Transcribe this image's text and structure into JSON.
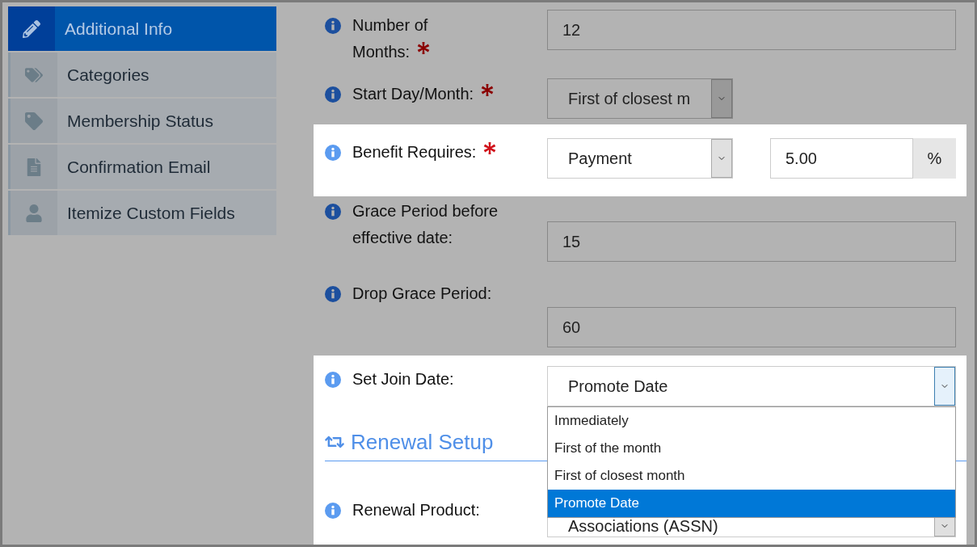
{
  "sidebar": {
    "items": [
      {
        "label": "Additional Info",
        "selected": true
      },
      {
        "label": "Categories",
        "selected": false
      },
      {
        "label": "Membership Status",
        "selected": false
      },
      {
        "label": "Confirmation Email",
        "selected": false
      },
      {
        "label": "Itemize Custom Fields",
        "selected": false
      }
    ]
  },
  "form": {
    "rows": [
      {
        "kind": "input",
        "label": "Number of Months:",
        "required": true,
        "highlighted": false,
        "value": "12"
      },
      {
        "kind": "select",
        "label": "Start Day/Month:",
        "required": true,
        "highlighted": false,
        "value": "First of closest m"
      },
      {
        "kind": "select_amount",
        "label": "Benefit Requires:",
        "required": true,
        "highlighted": true,
        "value": "Payment",
        "amount": "5.00",
        "unit": "%"
      },
      {
        "kind": "input",
        "label": "Grace Period before effective date:",
        "required": false,
        "highlighted": false,
        "value": "15"
      },
      {
        "kind": "stacked_input",
        "label": "Drop Grace Period:",
        "required": false,
        "highlighted": false,
        "value": "60"
      },
      {
        "kind": "open_select",
        "label": "Set Join Date:",
        "required": false,
        "highlighted": true,
        "value": "Promote Date",
        "options": [
          {
            "label": "Immediately",
            "selected": false
          },
          {
            "label": "First of the month",
            "selected": false
          },
          {
            "label": "First of closest month",
            "selected": false
          },
          {
            "label": "Promote Date",
            "selected": true
          }
        ]
      },
      {
        "kind": "heading",
        "label": "Renewal Setup",
        "highlighted": true
      },
      {
        "kind": "select",
        "label": "Renewal Product:",
        "required": false,
        "highlighted": true,
        "value": "Associations (ASSN)"
      }
    ]
  }
}
